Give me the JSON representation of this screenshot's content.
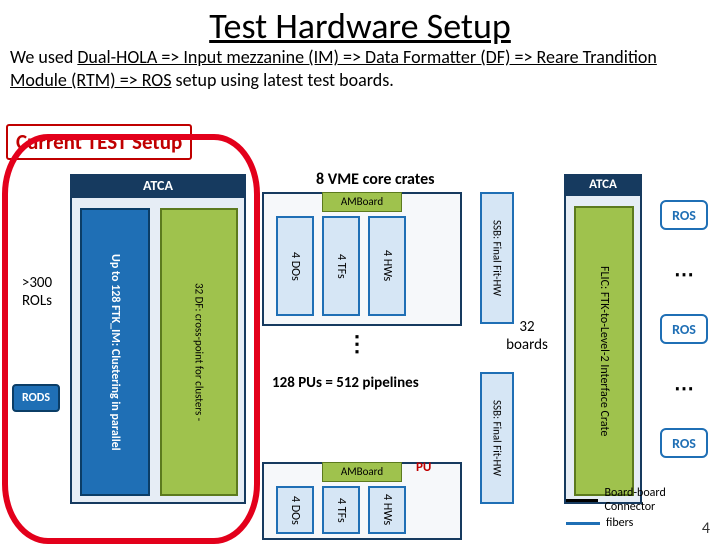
{
  "title": "Test Hardware Setup",
  "desc": {
    "pre": "We used ",
    "chain": "Dual-HOLA => Input mezzanine (IM) => Data Formatter (DF) => Reare Trandition Module (RTM) => ROS",
    "post": " setup using latest test boards."
  },
  "setup_label": "Current TEST Setup",
  "rols": ">300 ROLs",
  "rods": "RODS",
  "atca1": {
    "label": "ATCA",
    "im": "Up to 128 FTK_IM: Clustering in parallel",
    "df": "32 DF: cross-point for clusters -"
  },
  "vme_label": "8 VME core crates",
  "vme": {
    "amb": "AMBoard",
    "do": "4 DOs",
    "tf": "4 TFs",
    "hw": "4 HWs"
  },
  "pu": "PU",
  "pipeline": "128 PUs = 512 pipelines",
  "vdots": "⋮",
  "ssb": "SSB: Final Fit-HW",
  "boards32": "32 boards",
  "atca2": {
    "label": "ATCA",
    "flic": "FLIC: FTK-to-Level-2 Interface Crate"
  },
  "ros": "ROS",
  "rdots": "⋯",
  "legend": {
    "bb": "Board-board Connector",
    "fb": "fibers"
  },
  "page": "4"
}
